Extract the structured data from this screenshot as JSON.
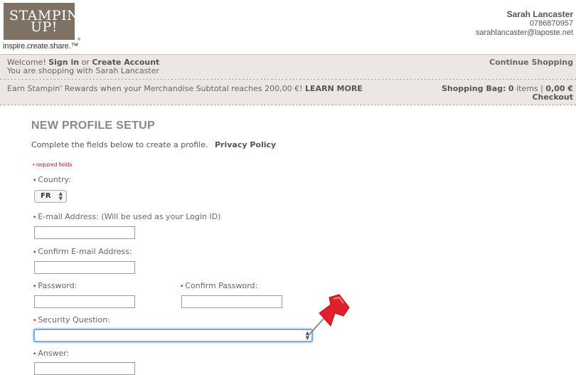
{
  "brand": {
    "logo_line1": "STAMPIN'",
    "logo_line2": "UP!",
    "registered": "®",
    "tagline": "inspire.create.share.™"
  },
  "demonstrator": {
    "name": "Sarah Lancaster",
    "phone": "0786870957",
    "email": "sarahlancaster@laposte.net"
  },
  "nav": {
    "welcome": "Welcome!",
    "sign_in": "Sign in",
    "or": "or",
    "create_account": "Create Account",
    "shopping_with": "You are shopping with Sarah Lancaster",
    "continue_shopping": "Continue Shopping",
    "rewards_text": "Earn Stampin' Rewards when your Merchandise Subtotal reaches 200,00 €!",
    "learn_more": "LEARN MORE",
    "bag_label": "Shopping Bag:",
    "bag_count": "0",
    "items_word": "items",
    "separator": "|",
    "bag_total": "0,00 €",
    "checkout": "Checkout"
  },
  "form": {
    "title": "NEW PROFILE SETUP",
    "intro": "Complete the fields below to create a profile.",
    "privacy_policy": "Privacy Policy",
    "required_note": "required fields",
    "required_marker": "•",
    "country_label": "Country:",
    "country_value": "FR",
    "email_label": "E-mail Address: (Will be used as your Login ID)",
    "email_value": "",
    "confirm_email_label": "Confirm E-mail Address:",
    "confirm_email_value": "",
    "password_label": "Password:",
    "confirm_password_label": "Confirm Password:",
    "security_question_label": "Security Question:",
    "security_question_value": "",
    "answer_label": "Answer:"
  },
  "colors": {
    "logo_bg": "#7d7264",
    "band_bg": "#ede7e3",
    "required_red": "#c02020",
    "focus_blue": "#7aaee0",
    "pin_red": "#e0202a"
  },
  "icons": {
    "select_arrows": "⌃⌄",
    "pin": "push-pin-icon"
  }
}
